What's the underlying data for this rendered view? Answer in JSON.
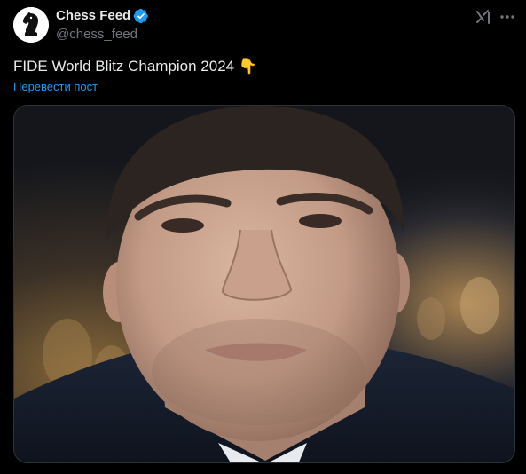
{
  "post": {
    "author": {
      "display_name": "Chess Feed",
      "handle": "@chess_feed",
      "verified": true,
      "avatar_icon": "chess-knight-logo"
    },
    "actions": {
      "grok_icon": "grok-icon",
      "more_icon": "more-dots-icon"
    },
    "text": "FIDE World Blitz Champion 2024",
    "text_emoji": "👇",
    "translate_label": "Перевести пост",
    "media": {
      "type": "photo",
      "description_icon": "portrait-photo"
    }
  },
  "colors": {
    "background": "#000000",
    "primary_text": "#e7e9ea",
    "secondary_text": "#71767b",
    "link": "#1d9bf0",
    "verified_badge": "#1d9bf0",
    "border": "#2f3336"
  }
}
